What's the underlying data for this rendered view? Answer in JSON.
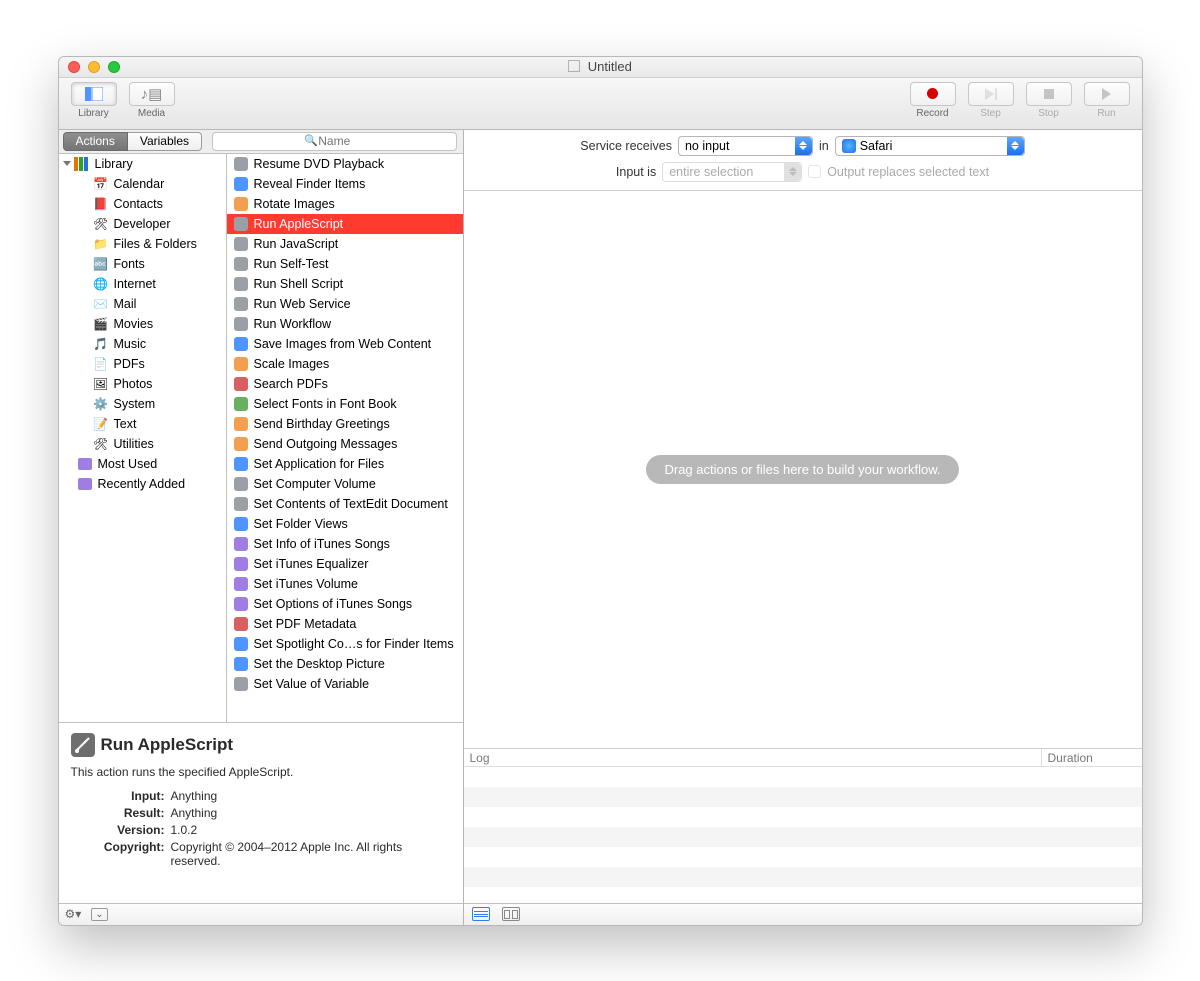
{
  "window": {
    "title": "Untitled"
  },
  "toolbar": {
    "library_label": "Library",
    "media_label": "Media",
    "record_label": "Record",
    "step_label": "Step",
    "stop_label": "Stop",
    "run_label": "Run"
  },
  "libheader": {
    "actions_tab": "Actions",
    "variables_tab": "Variables",
    "search_placeholder": "Name"
  },
  "categories": {
    "top": "Library",
    "items": [
      "Calendar",
      "Contacts",
      "Developer",
      "Files & Folders",
      "Fonts",
      "Internet",
      "Mail",
      "Movies",
      "Music",
      "PDFs",
      "Photos",
      "System",
      "Text",
      "Utilities"
    ],
    "extras": [
      "Most Used",
      "Recently Added"
    ]
  },
  "actions": {
    "items": [
      "Resume DVD Playback",
      "Reveal Finder Items",
      "Rotate Images",
      "Run AppleScript",
      "Run JavaScript",
      "Run Self-Test",
      "Run Shell Script",
      "Run Web Service",
      "Run Workflow",
      "Save Images from Web Content",
      "Scale Images",
      "Search PDFs",
      "Select Fonts in Font Book",
      "Send Birthday Greetings",
      "Send Outgoing Messages",
      "Set Application for Files",
      "Set Computer Volume",
      "Set Contents of TextEdit Document",
      "Set Folder Views",
      "Set Info of iTunes Songs",
      "Set iTunes Equalizer",
      "Set iTunes Volume",
      "Set Options of iTunes Songs",
      "Set PDF Metadata",
      "Set Spotlight Co…s for Finder Items",
      "Set the Desktop Picture",
      "Set Value of Variable"
    ],
    "selected_index": 3
  },
  "info": {
    "title": "Run AppleScript",
    "desc": "This action runs the specified AppleScript.",
    "input_label": "Input:",
    "input_value": "Anything",
    "result_label": "Result:",
    "result_value": "Anything",
    "version_label": "Version:",
    "version_value": "1.0.2",
    "copyright_label": "Copyright:",
    "copyright_value": "Copyright © 2004–2012 Apple Inc.  All rights reserved."
  },
  "config": {
    "receives_label": "Service receives",
    "receives_value": "no input",
    "in_label": "in",
    "in_value": "Safari",
    "input_is_label": "Input is",
    "input_is_value": "entire selection",
    "checkbox_label": "Output replaces selected text"
  },
  "workflow": {
    "placeholder": "Drag actions or files here to build your workflow."
  },
  "log": {
    "col1": "Log",
    "col2": "Duration"
  }
}
